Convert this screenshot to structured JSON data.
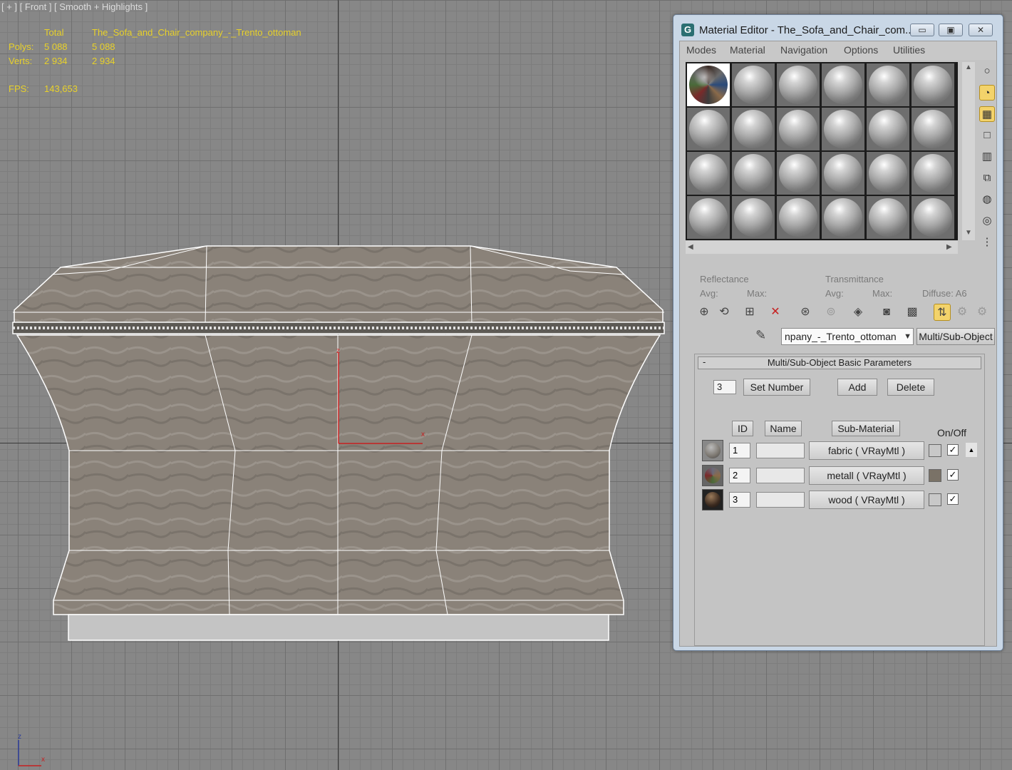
{
  "viewport": {
    "label": "[ + ] [ Front ] [ Smooth + Highlights ]",
    "stats": {
      "header_total": "Total",
      "header_object": "The_Sofa_and_Chair_company_-_Trento_ottoman",
      "polys_label": "Polys:",
      "polys_total": "5 088",
      "polys_object": "5 088",
      "verts_label": "Verts:",
      "verts_total": "2 934",
      "verts_object": "2 934",
      "fps_label": "FPS:",
      "fps_value": "143,653"
    },
    "gizmo": {
      "z": "z",
      "x": "x"
    },
    "pivot": {
      "z": "z",
      "x": "x"
    }
  },
  "editor": {
    "title": "Material Editor - The_Sofa_and_Chair_com...",
    "app_icon": "G",
    "menu": [
      "Modes",
      "Material",
      "Navigation",
      "Options",
      "Utilities"
    ],
    "reflectance": {
      "label": "Reflectance",
      "avg": "Avg:",
      "max": "Max:"
    },
    "transmittance": {
      "label": "Transmittance",
      "avg": "Avg:",
      "max": "Max:",
      "diffuse": "Diffuse: A6"
    },
    "material_name": "npany_-_Trento_ottoman",
    "material_type": "Multi/Sub-Object",
    "rollout": {
      "title": "Multi/Sub-Object Basic Parameters",
      "count": "3",
      "set_number": "Set Number",
      "add": "Add",
      "delete": "Delete",
      "col_id": "ID",
      "col_name": "Name",
      "col_sub": "Sub-Material",
      "col_onoff": "On/Off",
      "rows": [
        {
          "id": "1",
          "sub": "fabric  ( VRayMtl )",
          "swatch": "#c8c8c8",
          "thumb": "#7c7770",
          "checked": "✓"
        },
        {
          "id": "2",
          "sub": "metall  ( VRayMtl )",
          "swatch": "#7a7267",
          "thumb": "#6a6a7a",
          "checked": "✓"
        },
        {
          "id": "3",
          "sub": "wood  ( VRayMtl )",
          "swatch": "#c8c8c8",
          "thumb": "#3b2a1f",
          "checked": "✓"
        }
      ]
    }
  },
  "colors": {
    "stats_text": "#e8d12a",
    "fabric": "#8a8279",
    "wire": "#ffffff",
    "active_tool": "#f3d36b"
  }
}
